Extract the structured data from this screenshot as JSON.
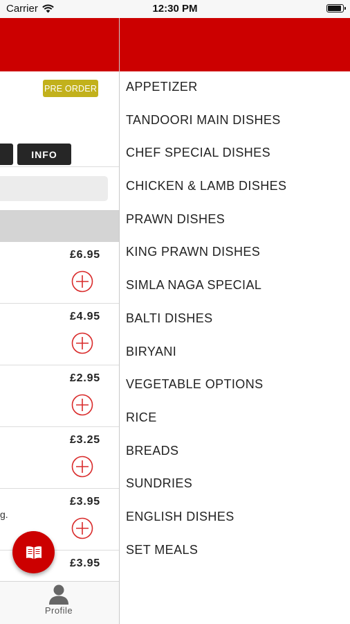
{
  "status_bar": {
    "carrier": "Carrier",
    "time": "12:30 PM",
    "battery_level": 0.95
  },
  "background_screen": {
    "preorder_label": "PRE ORDER",
    "tabs": {
      "info_label": "INFO"
    },
    "menu_items": [
      {
        "price": "£6.95",
        "add_icon": "plus-circle-icon",
        "partial_text": ""
      },
      {
        "price": "£4.95",
        "add_icon": "plus-circle-icon",
        "partial_text": ""
      },
      {
        "price": "£2.95",
        "add_icon": "plus-circle-icon",
        "partial_text": ""
      },
      {
        "price": "£3.25",
        "add_icon": "plus-circle-icon",
        "partial_text": ""
      },
      {
        "price": "£3.95",
        "add_icon": "plus-circle-icon",
        "partial_text": "g."
      },
      {
        "price": "£3.95",
        "add_icon": "plus-circle-icon",
        "partial_text": ""
      }
    ],
    "fab_icon": "menu-book-icon",
    "bottom_nav": {
      "profile_label": "Profile",
      "profile_icon": "person-icon"
    }
  },
  "drawer": {
    "categories": [
      "APPETIZER",
      "TANDOORI MAIN DISHES",
      "CHEF SPECIAL DISHES",
      "CHICKEN & LAMB DISHES",
      "PRAWN DISHES",
      "KING PRAWN DISHES",
      "SIMLA NAGA SPECIAL",
      "BALTI DISHES",
      "BIRYANI",
      "VEGETABLE OPTIONS",
      "RICE",
      "BREADS",
      "SUNDRIES",
      "ENGLISH DISHES",
      "SET MEALS"
    ]
  },
  "colors": {
    "brand_red": "#cc0000",
    "preorder_gold": "#c2b11c",
    "dark_button": "#262626",
    "section_gray": "#d4d4d4"
  }
}
